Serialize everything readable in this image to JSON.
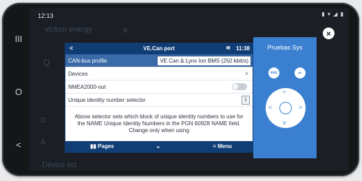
{
  "phone": {
    "status_time": "12:13",
    "status_icons": "▮ ▾ ◢ ▮",
    "nav": [
      "III",
      "O",
      "<"
    ]
  },
  "background": {
    "brand": "victron energy",
    "close": "×",
    "search": "Q",
    "d": "D",
    "a": "A",
    "device": "Device list"
  },
  "overlay_close": "×",
  "gx": {
    "back": "<",
    "title": "VE.Can port",
    "wifi": "≋",
    "clock": "11:38",
    "rows": [
      {
        "label": "CAN-bus profile",
        "value": "VE.Can & Lynx Ion BMS (250 kbit/s)"
      },
      {
        "label": "Devices"
      },
      {
        "label": "NMEA2000-out"
      },
      {
        "label": "Unique identity number selector",
        "value": "1"
      }
    ],
    "description": "Above selector sets which block of unique identity numbers to use for the NAME Unique Identity Numbers in the PGN 60928 NAME field. Change only when using",
    "footer": {
      "pages": "Pages",
      "chevron": "⌄",
      "menu": "Menu"
    }
  },
  "sidepanel": {
    "title": "Pruebas Sys",
    "esc": "esc",
    "enter": "↵",
    "dpad": {
      "up": "^",
      "down": "v",
      "left": "<",
      "right": ">"
    }
  },
  "colors": {
    "header": "#0f3d74",
    "selected_row": "#3a6aa8",
    "sidepanel": "#3a7fd0"
  }
}
